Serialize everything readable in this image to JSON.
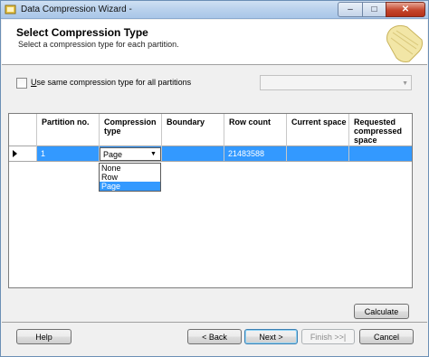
{
  "window": {
    "title": "Data Compression Wizard -"
  },
  "titlebar_buttons": {
    "minimize": "–",
    "maximize": "□",
    "close": "✕"
  },
  "header": {
    "title": "Select Compression Type",
    "subtitle": "Select a compression type for each partition."
  },
  "options": {
    "same_type_label_underlined": "U",
    "same_type_label_rest": "se same compression type for all partitions",
    "same_type_checked": false,
    "same_type_combo_value": ""
  },
  "grid": {
    "columns": [
      "Partition no.",
      "Compression type",
      "Boundary",
      "Row count",
      "Current space",
      "Requested compressed space"
    ],
    "rows": [
      {
        "partition": "1",
        "compression_type": "Page",
        "boundary": "",
        "row_count": "21483588",
        "current_space": "",
        "requested_space": ""
      }
    ],
    "dropdown_options": [
      "None",
      "Row",
      "Page"
    ],
    "dropdown_selected": "Page"
  },
  "buttons": {
    "calculate": "Calculate",
    "help": "Help",
    "back": "< Back",
    "next": "Next >",
    "finish": "Finish >>|",
    "cancel": "Cancel"
  },
  "colors": {
    "selection": "#3399ff",
    "titlebar": "#b9d1ec",
    "close": "#c4452c"
  }
}
